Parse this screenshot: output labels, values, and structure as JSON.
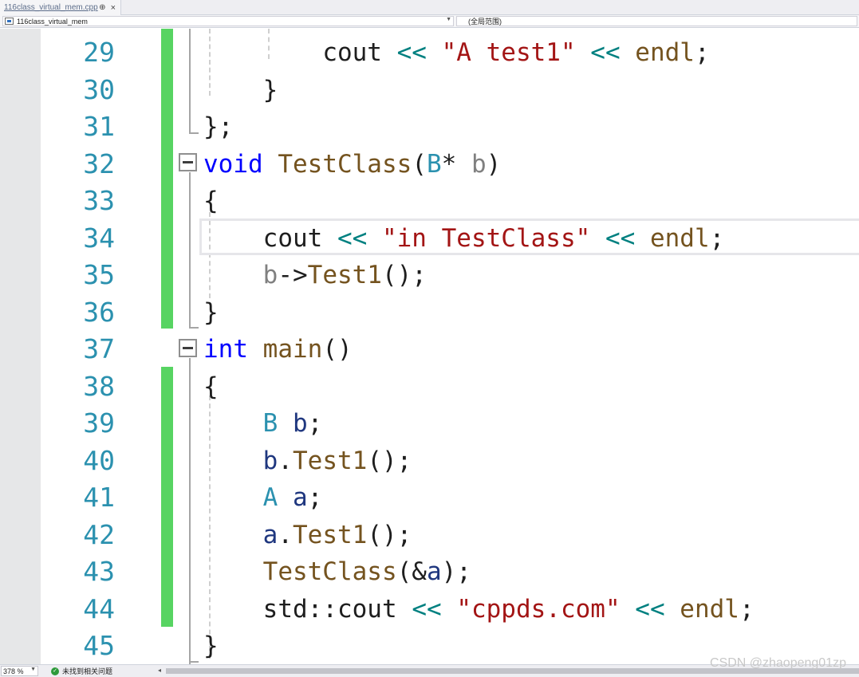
{
  "tab": {
    "title": "116class_virtual_mem.cpp",
    "pin": "⊕",
    "close": "×"
  },
  "navbar": {
    "file_scope": "116class_virtual_mem",
    "member_scope": "(全局范围)"
  },
  "editor": {
    "line_numbers": [
      "29",
      "30",
      "31",
      "32",
      "33",
      "34",
      "35",
      "36",
      "37",
      "38",
      "39",
      "40",
      "41",
      "42",
      "43",
      "44",
      "45"
    ],
    "lines": [
      [
        {
          "t": "        "
        },
        {
          "t": "cout",
          "c": "dflt"
        },
        {
          "t": " "
        },
        {
          "t": "<<",
          "c": "op"
        },
        {
          "t": " "
        },
        {
          "t": "\"A test1\"",
          "c": "str"
        },
        {
          "t": " "
        },
        {
          "t": "<<",
          "c": "op"
        },
        {
          "t": " "
        },
        {
          "t": "endl",
          "c": "fn"
        },
        {
          "t": ";"
        }
      ],
      [
        {
          "t": "    }"
        }
      ],
      [
        {
          "t": "};"
        }
      ],
      [
        {
          "t": "void",
          "c": "kw"
        },
        {
          "t": " "
        },
        {
          "t": "TestClass",
          "c": "fn"
        },
        {
          "t": "("
        },
        {
          "t": "B",
          "c": "type"
        },
        {
          "t": "* "
        },
        {
          "t": "b",
          "c": "param"
        },
        {
          "t": ")"
        }
      ],
      [
        {
          "t": "{"
        }
      ],
      [
        {
          "t": "    "
        },
        {
          "t": "cout",
          "c": "dflt"
        },
        {
          "t": " "
        },
        {
          "t": "<<",
          "c": "op"
        },
        {
          "t": " "
        },
        {
          "t": "\"in TestClass\"",
          "c": "str"
        },
        {
          "t": " "
        },
        {
          "t": "<<",
          "c": "op"
        },
        {
          "t": " "
        },
        {
          "t": "endl",
          "c": "fn"
        },
        {
          "t": ";"
        }
      ],
      [
        {
          "t": "    "
        },
        {
          "t": "b",
          "c": "param"
        },
        {
          "t": "->"
        },
        {
          "t": "Test1",
          "c": "fn"
        },
        {
          "t": "();"
        }
      ],
      [
        {
          "t": "}"
        }
      ],
      [
        {
          "t": "int",
          "c": "kw"
        },
        {
          "t": " "
        },
        {
          "t": "main",
          "c": "fn"
        },
        {
          "t": "()"
        }
      ],
      [
        {
          "t": "{"
        }
      ],
      [
        {
          "t": "    "
        },
        {
          "t": "B",
          "c": "type"
        },
        {
          "t": " "
        },
        {
          "t": "b",
          "c": "var"
        },
        {
          "t": ";"
        }
      ],
      [
        {
          "t": "    "
        },
        {
          "t": "b",
          "c": "var"
        },
        {
          "t": "."
        },
        {
          "t": "Test1",
          "c": "fn"
        },
        {
          "t": "();"
        }
      ],
      [
        {
          "t": "    "
        },
        {
          "t": "A",
          "c": "type"
        },
        {
          "t": " "
        },
        {
          "t": "a",
          "c": "var"
        },
        {
          "t": ";"
        }
      ],
      [
        {
          "t": "    "
        },
        {
          "t": "a",
          "c": "var"
        },
        {
          "t": "."
        },
        {
          "t": "Test1",
          "c": "fn"
        },
        {
          "t": "();"
        }
      ],
      [
        {
          "t": "    "
        },
        {
          "t": "TestClass",
          "c": "fn"
        },
        {
          "t": "(&"
        },
        {
          "t": "a",
          "c": "var"
        },
        {
          "t": ");"
        }
      ],
      [
        {
          "t": "    "
        },
        {
          "t": "std",
          "c": "dflt"
        },
        {
          "t": "::"
        },
        {
          "t": "cout",
          "c": "dflt"
        },
        {
          "t": " "
        },
        {
          "t": "<<",
          "c": "op"
        },
        {
          "t": " "
        },
        {
          "t": "\"cppds.com\"",
          "c": "str"
        },
        {
          "t": " "
        },
        {
          "t": "<<",
          "c": "op"
        },
        {
          "t": " "
        },
        {
          "t": "endl",
          "c": "fn"
        },
        {
          "t": ";"
        }
      ],
      [
        {
          "t": "}"
        }
      ]
    ]
  },
  "statusbar": {
    "zoom": "378 %",
    "issues": "未找到相关问题"
  },
  "watermark": "CSDN @zhaopeng01zp",
  "colors": {
    "change_bar": "#57d462",
    "line_number": "#2b91af",
    "keyword": "#0000ff",
    "string": "#a31515",
    "function": "#74531f"
  }
}
